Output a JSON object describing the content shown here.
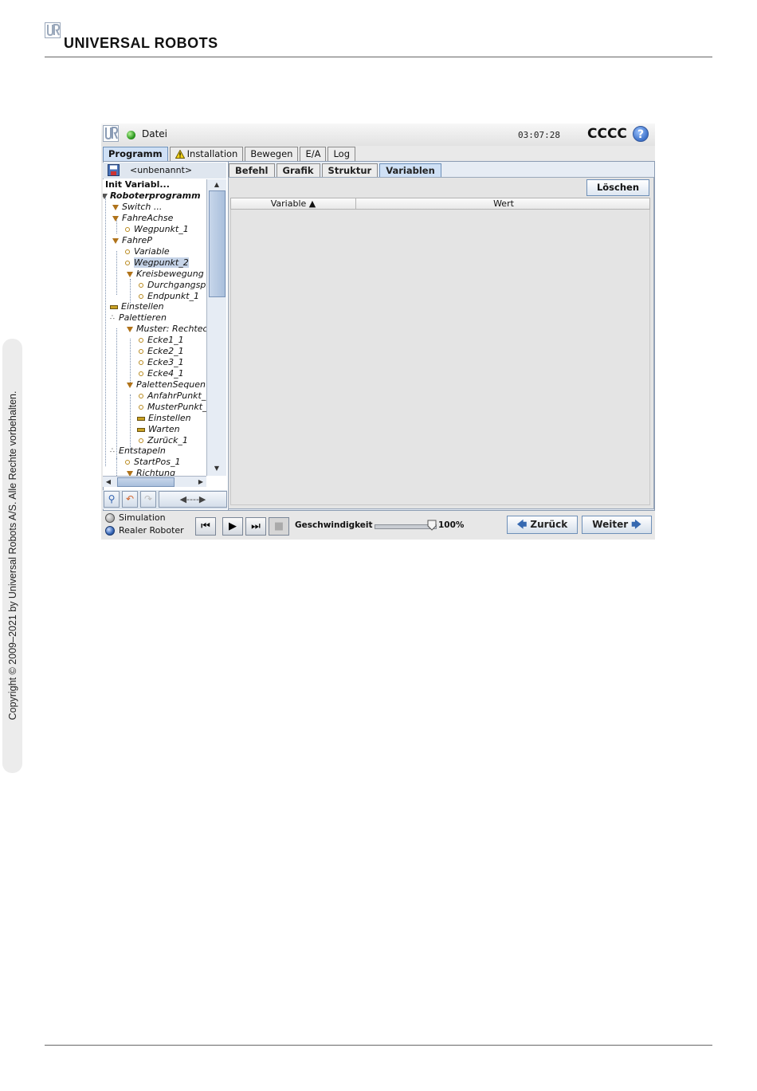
{
  "header": {
    "brand": "UNIVERSAL ROBOTS",
    "brand_mark": "UR"
  },
  "sidebar_note": "Copyright © 2009–2021 by Universal Robots A/S. Alle Rechte vorbehalten.",
  "app": {
    "top": {
      "logo": "UR",
      "file_menu": "Datei",
      "clock": "03:07:28",
      "robot_name": "CCCC",
      "help_icon": "?"
    },
    "main_tabs": [
      "Programm",
      "Installation",
      "Bewegen",
      "E/A",
      "Log"
    ],
    "program_name": "<unbenannt>",
    "tree": [
      {
        "label": "Init Variabl...",
        "style": "bold-normal"
      },
      {
        "label": "Roboterprogramm",
        "style": "bold"
      },
      {
        "label": "Switch ...",
        "icon": "tri"
      },
      {
        "label": "FahreAchse",
        "icon": "tri"
      },
      {
        "label": "Wegpunkt_1",
        "icon": "dot"
      },
      {
        "label": "FahreP",
        "icon": "tri"
      },
      {
        "label": "Variable",
        "icon": "dot"
      },
      {
        "label": "Wegpunkt_2",
        "icon": "dot",
        "selected": true
      },
      {
        "label": "Kreisbewegung",
        "icon": "tri"
      },
      {
        "label": "Durchgangspu",
        "icon": "dot"
      },
      {
        "label": "Endpunkt_1",
        "icon": "dot"
      },
      {
        "label": "Einstellen",
        "icon": "bar"
      },
      {
        "label": "Palettieren",
        "icon": "pal"
      },
      {
        "label": "Muster: Rechtec",
        "icon": "tri"
      },
      {
        "label": "Ecke1_1",
        "icon": "dot"
      },
      {
        "label": "Ecke2_1",
        "icon": "dot"
      },
      {
        "label": "Ecke3_1",
        "icon": "dot"
      },
      {
        "label": "Ecke4_1",
        "icon": "dot"
      },
      {
        "label": "PalettenSequen",
        "icon": "tri"
      },
      {
        "label": "AnfahrPunkt_",
        "icon": "dot"
      },
      {
        "label": "MusterPunkt_",
        "icon": "dot"
      },
      {
        "label": "Einstellen",
        "icon": "bar"
      },
      {
        "label": "Warten",
        "icon": "bar"
      },
      {
        "label": "Zurück_1",
        "icon": "dot"
      },
      {
        "label": "Entstapeln",
        "icon": "pal"
      },
      {
        "label": "StartPos_1",
        "icon": "dot"
      },
      {
        "label": "Richtung",
        "icon": "tri"
      }
    ],
    "sub_tabs": [
      "Befehl",
      "Grafik",
      "Struktur",
      "Variablen"
    ],
    "delete_button": "Löschen",
    "table": {
      "col_variable": "Variable ▲",
      "col_value": "Wert"
    },
    "mode": {
      "simulation": "Simulation",
      "real": "Realer Roboter"
    },
    "speed": {
      "label": "Geschwindigkeit",
      "value": "100%",
      "level": 1.0
    },
    "back_button": "Zurück",
    "next_button": "Weiter"
  }
}
